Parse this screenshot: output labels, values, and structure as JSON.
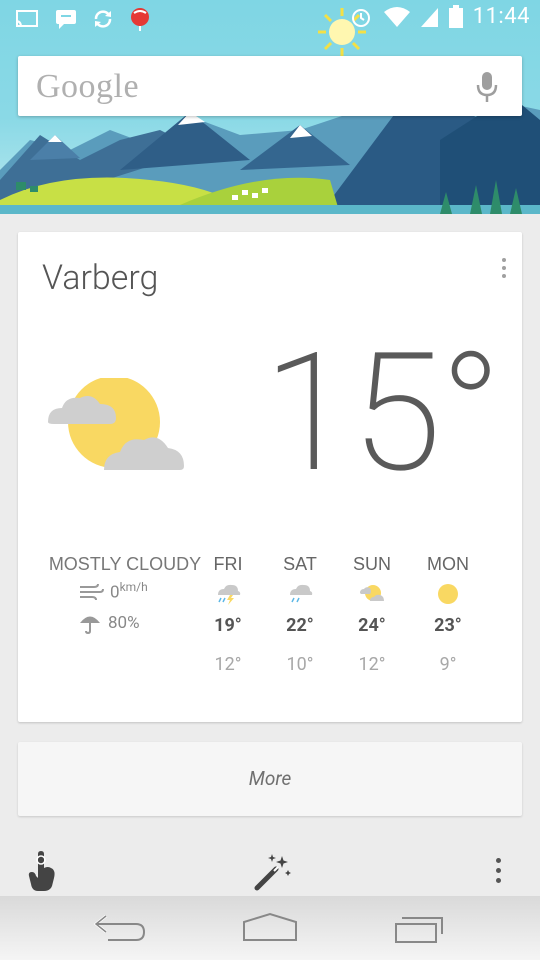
{
  "status_bar": {
    "time": "11:44",
    "left_icons": [
      "cast-icon",
      "hangouts-icon",
      "sync-icon",
      "balloon-icon"
    ],
    "right_icons": [
      "alarm-icon",
      "wifi-icon",
      "signal-icon",
      "battery-icon"
    ]
  },
  "search": {
    "logo": "Google",
    "mic_icon": "mic-icon"
  },
  "weather": {
    "city": "Varberg",
    "temperature": "15°",
    "condition": "MOSTLY CLOUDY",
    "wind_value": "0",
    "wind_unit": "km/h",
    "precipitation": "80%",
    "forecast": [
      {
        "day": "FRI",
        "icon": "rain-thunder-icon",
        "high": "19°",
        "low": "12°"
      },
      {
        "day": "SAT",
        "icon": "rain-cloud-icon",
        "high": "22°",
        "low": "10°"
      },
      {
        "day": "SUN",
        "icon": "partly-cloudy-icon",
        "high": "24°",
        "low": "12°"
      },
      {
        "day": "MON",
        "icon": "sun-icon",
        "high": "23°",
        "low": "9°"
      }
    ]
  },
  "more_label": "More",
  "toolbar": {
    "left_icon": "reminder-finger-icon",
    "center_icon": "magic-wand-icon",
    "right_icon": "overflow-menu-icon"
  },
  "navbar": {
    "buttons": [
      "back-icon",
      "home-icon",
      "recent-apps-icon"
    ]
  },
  "colors": {
    "sky": "#8ad9e6",
    "mountain_dark": "#2f5e87",
    "grass": "#c8e045",
    "sun": "#f9d862",
    "cloud": "#cfcfcf"
  }
}
